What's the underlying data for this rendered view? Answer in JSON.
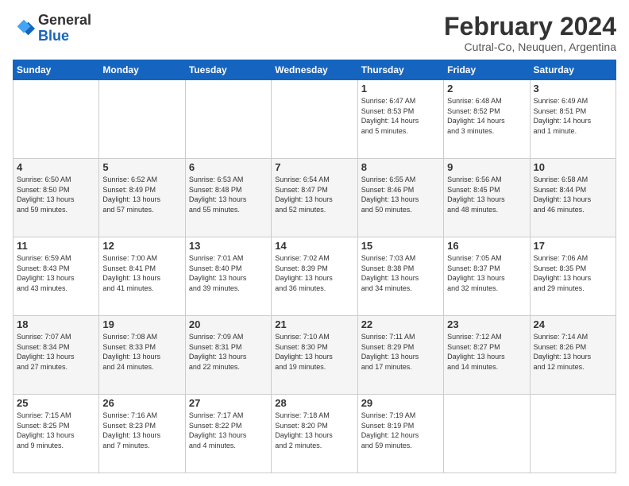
{
  "header": {
    "logo_general": "General",
    "logo_blue": "Blue",
    "month_title": "February 2024",
    "location": "Cutral-Co, Neuquen, Argentina"
  },
  "weekdays": [
    "Sunday",
    "Monday",
    "Tuesday",
    "Wednesday",
    "Thursday",
    "Friday",
    "Saturday"
  ],
  "weeks": [
    [
      {
        "day": "",
        "detail": ""
      },
      {
        "day": "",
        "detail": ""
      },
      {
        "day": "",
        "detail": ""
      },
      {
        "day": "",
        "detail": ""
      },
      {
        "day": "1",
        "detail": "Sunrise: 6:47 AM\nSunset: 8:53 PM\nDaylight: 14 hours\nand 5 minutes."
      },
      {
        "day": "2",
        "detail": "Sunrise: 6:48 AM\nSunset: 8:52 PM\nDaylight: 14 hours\nand 3 minutes."
      },
      {
        "day": "3",
        "detail": "Sunrise: 6:49 AM\nSunset: 8:51 PM\nDaylight: 14 hours\nand 1 minute."
      }
    ],
    [
      {
        "day": "4",
        "detail": "Sunrise: 6:50 AM\nSunset: 8:50 PM\nDaylight: 13 hours\nand 59 minutes."
      },
      {
        "day": "5",
        "detail": "Sunrise: 6:52 AM\nSunset: 8:49 PM\nDaylight: 13 hours\nand 57 minutes."
      },
      {
        "day": "6",
        "detail": "Sunrise: 6:53 AM\nSunset: 8:48 PM\nDaylight: 13 hours\nand 55 minutes."
      },
      {
        "day": "7",
        "detail": "Sunrise: 6:54 AM\nSunset: 8:47 PM\nDaylight: 13 hours\nand 52 minutes."
      },
      {
        "day": "8",
        "detail": "Sunrise: 6:55 AM\nSunset: 8:46 PM\nDaylight: 13 hours\nand 50 minutes."
      },
      {
        "day": "9",
        "detail": "Sunrise: 6:56 AM\nSunset: 8:45 PM\nDaylight: 13 hours\nand 48 minutes."
      },
      {
        "day": "10",
        "detail": "Sunrise: 6:58 AM\nSunset: 8:44 PM\nDaylight: 13 hours\nand 46 minutes."
      }
    ],
    [
      {
        "day": "11",
        "detail": "Sunrise: 6:59 AM\nSunset: 8:43 PM\nDaylight: 13 hours\nand 43 minutes."
      },
      {
        "day": "12",
        "detail": "Sunrise: 7:00 AM\nSunset: 8:41 PM\nDaylight: 13 hours\nand 41 minutes."
      },
      {
        "day": "13",
        "detail": "Sunrise: 7:01 AM\nSunset: 8:40 PM\nDaylight: 13 hours\nand 39 minutes."
      },
      {
        "day": "14",
        "detail": "Sunrise: 7:02 AM\nSunset: 8:39 PM\nDaylight: 13 hours\nand 36 minutes."
      },
      {
        "day": "15",
        "detail": "Sunrise: 7:03 AM\nSunset: 8:38 PM\nDaylight: 13 hours\nand 34 minutes."
      },
      {
        "day": "16",
        "detail": "Sunrise: 7:05 AM\nSunset: 8:37 PM\nDaylight: 13 hours\nand 32 minutes."
      },
      {
        "day": "17",
        "detail": "Sunrise: 7:06 AM\nSunset: 8:35 PM\nDaylight: 13 hours\nand 29 minutes."
      }
    ],
    [
      {
        "day": "18",
        "detail": "Sunrise: 7:07 AM\nSunset: 8:34 PM\nDaylight: 13 hours\nand 27 minutes."
      },
      {
        "day": "19",
        "detail": "Sunrise: 7:08 AM\nSunset: 8:33 PM\nDaylight: 13 hours\nand 24 minutes."
      },
      {
        "day": "20",
        "detail": "Sunrise: 7:09 AM\nSunset: 8:31 PM\nDaylight: 13 hours\nand 22 minutes."
      },
      {
        "day": "21",
        "detail": "Sunrise: 7:10 AM\nSunset: 8:30 PM\nDaylight: 13 hours\nand 19 minutes."
      },
      {
        "day": "22",
        "detail": "Sunrise: 7:11 AM\nSunset: 8:29 PM\nDaylight: 13 hours\nand 17 minutes."
      },
      {
        "day": "23",
        "detail": "Sunrise: 7:12 AM\nSunset: 8:27 PM\nDaylight: 13 hours\nand 14 minutes."
      },
      {
        "day": "24",
        "detail": "Sunrise: 7:14 AM\nSunset: 8:26 PM\nDaylight: 13 hours\nand 12 minutes."
      }
    ],
    [
      {
        "day": "25",
        "detail": "Sunrise: 7:15 AM\nSunset: 8:25 PM\nDaylight: 13 hours\nand 9 minutes."
      },
      {
        "day": "26",
        "detail": "Sunrise: 7:16 AM\nSunset: 8:23 PM\nDaylight: 13 hours\nand 7 minutes."
      },
      {
        "day": "27",
        "detail": "Sunrise: 7:17 AM\nSunset: 8:22 PM\nDaylight: 13 hours\nand 4 minutes."
      },
      {
        "day": "28",
        "detail": "Sunrise: 7:18 AM\nSunset: 8:20 PM\nDaylight: 13 hours\nand 2 minutes."
      },
      {
        "day": "29",
        "detail": "Sunrise: 7:19 AM\nSunset: 8:19 PM\nDaylight: 12 hours\nand 59 minutes."
      },
      {
        "day": "",
        "detail": ""
      },
      {
        "day": "",
        "detail": ""
      }
    ]
  ]
}
